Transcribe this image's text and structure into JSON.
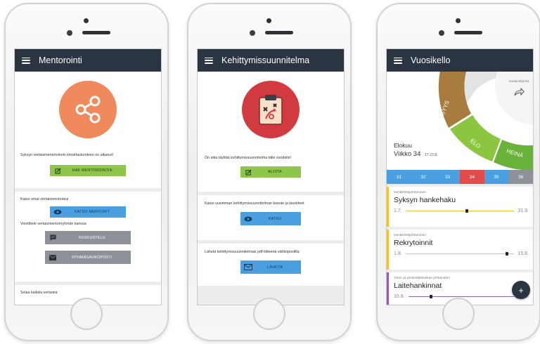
{
  "colors": {
    "appbar": "#2b3441",
    "green_button": "#8dc64b",
    "blue_button": "#4a9fe0",
    "gray_button": "#8c9297",
    "week_selected": "#e34b4b",
    "week_normal": "#4a9fe0",
    "task_yellow": "#f1c232",
    "task_purple": "#8f5fb0"
  },
  "phone1": {
    "title": "Mentorointi",
    "hero_icon": "share-icon",
    "notice": "Syksyn vertaismentoroinnin ilmoittautuminen on alkanut!",
    "apply_button": "HAE MENTOROINTIA",
    "view_text": "Katso omat vertaismentoriesi",
    "view_button": "KATSO MENTORIT",
    "chat_text": "Viestittele vertaismentoriryhmän kanssa",
    "chat_button": "KESKUSTELU",
    "group_email_button": "RYHMÄSÄHKÖPOSTI",
    "browse_text": "Selaa kaikkia vertaisia"
  },
  "phone2": {
    "title": "Kehittymissuunnitelma",
    "hero_icon": "clipboard-icon",
    "notice": "On aika täyttää kehittymissuunnitelma tälle vuodelle!",
    "start_button": "ALOITA",
    "summary_text": "Katso uusimman kehittymissuunnitelman kooste ja tavoitteet",
    "view_button": "KATSO",
    "send_text": "Lähetä kehittymissuunnitelmasi pdf-liitteenä sähköpostilla",
    "send_button": "LÄHETÄ"
  },
  "phone3": {
    "title": "Vuosikello",
    "wheel": {
      "syys": "SYYS",
      "elo": "ELO",
      "heina": "HEINÄ",
      "year_view": "Vuosinäkymä"
    },
    "month": "Elokuu",
    "week_label": "Viikko 34",
    "week_range": "17-23.8.",
    "weeks": [
      "31",
      "32",
      "33",
      "34",
      "35",
      "36"
    ],
    "selected_week": "34",
    "tasks": [
      {
        "category": "Henkilöstöjohtaminen",
        "name": "Syksyn hankehaku",
        "start": "1.7.",
        "end": "31.9.",
        "color": "#f1c232",
        "progress": 0.55
      },
      {
        "category": "Henkilöstöjohtaminen",
        "name": "Rekrytoinnit",
        "start": "1.8.",
        "end": "15.8.",
        "color": "#f1c232",
        "progress": 0.92
      },
      {
        "category": "Tieto- ja viestintätekniikan johtaminen",
        "name": "Laitehankinnat",
        "start": "10.8.",
        "end": "15.8.",
        "color": "#8f5fb0",
        "progress": 0.2
      }
    ],
    "fab": "+"
  }
}
